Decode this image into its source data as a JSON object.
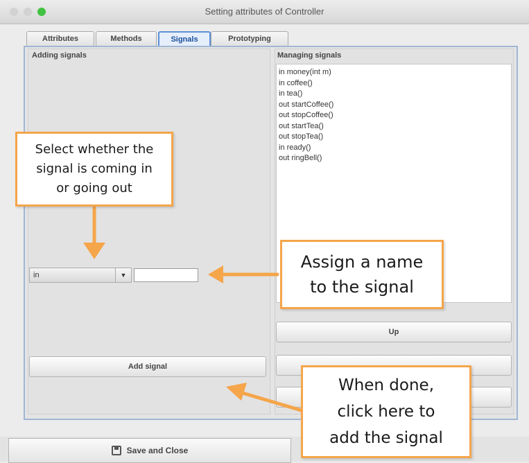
{
  "window": {
    "title": "Setting attributes of Controller"
  },
  "tabs": [
    {
      "label": "Attributes",
      "active": false
    },
    {
      "label": "Methods",
      "active": false
    },
    {
      "label": "Signals",
      "active": true
    },
    {
      "label": "Prototyping",
      "active": false
    }
  ],
  "adding": {
    "header": "Adding signals",
    "direction_value": "in",
    "name_value": "",
    "add_button": "Add signal"
  },
  "managing": {
    "header": "Managing signals",
    "signals": [
      "in money(int m)",
      "in coffee()",
      "in tea()",
      "out startCoffee()",
      "out stopCoffee()",
      "out startTea()",
      "out stopTea()",
      "in ready()",
      "out ringBell()"
    ],
    "up_button": "Up",
    "down_button": "",
    "remove_button": ""
  },
  "footer": {
    "save_label": "Save and Close"
  },
  "callouts": {
    "direction": [
      "Select whether the",
      "signal is coming in",
      "or going out"
    ],
    "name": [
      "Assign a name",
      "to the signal"
    ],
    "add": [
      "When done,",
      "click here to",
      "add the signal"
    ]
  },
  "colors": {
    "accent": "#5b8fd6",
    "callout_border": "#f5a54a",
    "arrow": "#f5a54a"
  },
  "icons": {
    "save": "save-icon",
    "dropdown": "chevron-down-icon"
  }
}
